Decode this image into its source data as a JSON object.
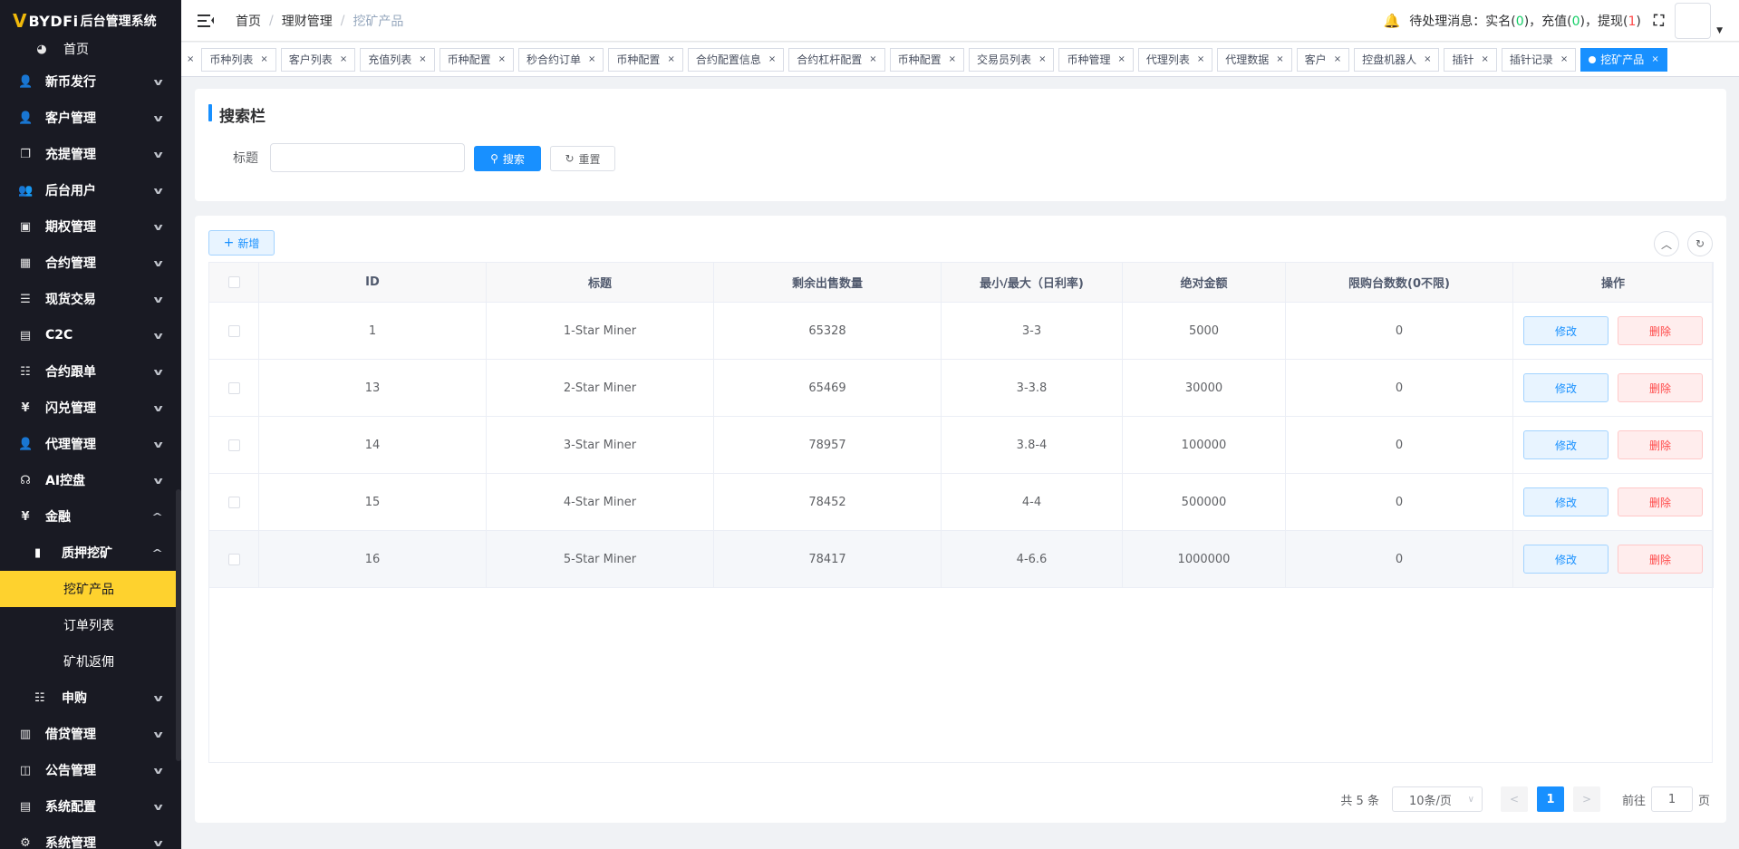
{
  "app": {
    "logo_mark": "V",
    "brand": "BYDFi",
    "system_name": "后台管理系统"
  },
  "sidebar": {
    "home": "首页",
    "items": [
      {
        "label": "新币发行",
        "icon": "user-icon"
      },
      {
        "label": "客户管理",
        "icon": "user-icon"
      },
      {
        "label": "充提管理",
        "icon": "copy-icon"
      },
      {
        "label": "后台用户",
        "icon": "users-icon"
      },
      {
        "label": "期权管理",
        "icon": "chart-icon"
      },
      {
        "label": "合约管理",
        "icon": "grid-icon"
      },
      {
        "label": "现货交易",
        "icon": "list-icon"
      },
      {
        "label": "C2C",
        "icon": "doc-icon"
      },
      {
        "label": "合约跟单",
        "icon": "list-tree-icon"
      },
      {
        "label": "闪兑管理",
        "icon": "yen-icon"
      },
      {
        "label": "代理管理",
        "icon": "user-icon"
      },
      {
        "label": "AI控盘",
        "icon": "robot-icon"
      },
      {
        "label": "金融",
        "icon": "yen-icon"
      }
    ],
    "submenu": {
      "label": "质押挖矿",
      "icon": "bar-chart-icon"
    },
    "leaves": [
      "挖矿产品",
      "订单列表",
      "矿机返佣"
    ],
    "after": [
      {
        "label": "申购",
        "icon": "list-tree-icon",
        "sub": true
      },
      {
        "label": "借贷管理",
        "icon": "book-icon"
      },
      {
        "label": "公告管理",
        "icon": "book-open-icon"
      },
      {
        "label": "系统配置",
        "icon": "doc-icon"
      },
      {
        "label": "系统管理",
        "icon": "gear-icon"
      }
    ]
  },
  "header": {
    "breadcrumb": [
      "首页",
      "理财管理",
      "挖矿产品"
    ],
    "notice_label": "待处理消息：",
    "notice_realname": "实名",
    "notice_realname_count": "0",
    "notice_recharge": "充值",
    "notice_recharge_count": "0",
    "notice_withdraw": "提现",
    "notice_withdraw_count": "1"
  },
  "tags": [
    "币种列表",
    "客户列表",
    "充值列表",
    "币种配置",
    "秒合约订单",
    "币种配置",
    "合约配置信息",
    "合约杠杆配置",
    "币种配置",
    "交易员列表",
    "币种管理",
    "代理列表",
    "代理数据",
    "客户",
    "控盘机器人",
    "插针",
    "插针记录"
  ],
  "active_tag": "挖矿产品",
  "search": {
    "title": "搜索栏",
    "field_label": "标题",
    "input_value": "",
    "search_button": "搜索",
    "reset_button": "重置"
  },
  "table": {
    "add_button": "新增",
    "columns": [
      "ID",
      "标题",
      "剩余出售数量",
      "最小/最大（日利率)",
      "绝对金额",
      "限购台数数(0不限)",
      "操作"
    ],
    "edit_label": "修改",
    "delete_label": "删除",
    "rows": [
      {
        "id": "1",
        "title": "1-Star Miner",
        "remaining": "65328",
        "rate": "3-3",
        "amount": "5000",
        "limit": "0"
      },
      {
        "id": "13",
        "title": "2-Star Miner",
        "remaining": "65469",
        "rate": "3-3.8",
        "amount": "30000",
        "limit": "0"
      },
      {
        "id": "14",
        "title": "3-Star Miner",
        "remaining": "78957",
        "rate": "3.8-4",
        "amount": "100000",
        "limit": "0"
      },
      {
        "id": "15",
        "title": "4-Star Miner",
        "remaining": "78452",
        "rate": "4-4",
        "amount": "500000",
        "limit": "0"
      },
      {
        "id": "16",
        "title": "5-Star Miner",
        "remaining": "78417",
        "rate": "4-6.6",
        "amount": "1000000",
        "limit": "0"
      }
    ]
  },
  "pagination": {
    "total": "共 5 条",
    "page_size": "10条/页",
    "current_page": "1",
    "goto_label": "前往",
    "goto_value": "1",
    "goto_unit": "页"
  },
  "colors": {
    "primary": "#1890ff",
    "sidebar_bg": "#191a23",
    "active_menu": "#fed22e",
    "danger": "#ff4949",
    "success": "#13ce66"
  }
}
